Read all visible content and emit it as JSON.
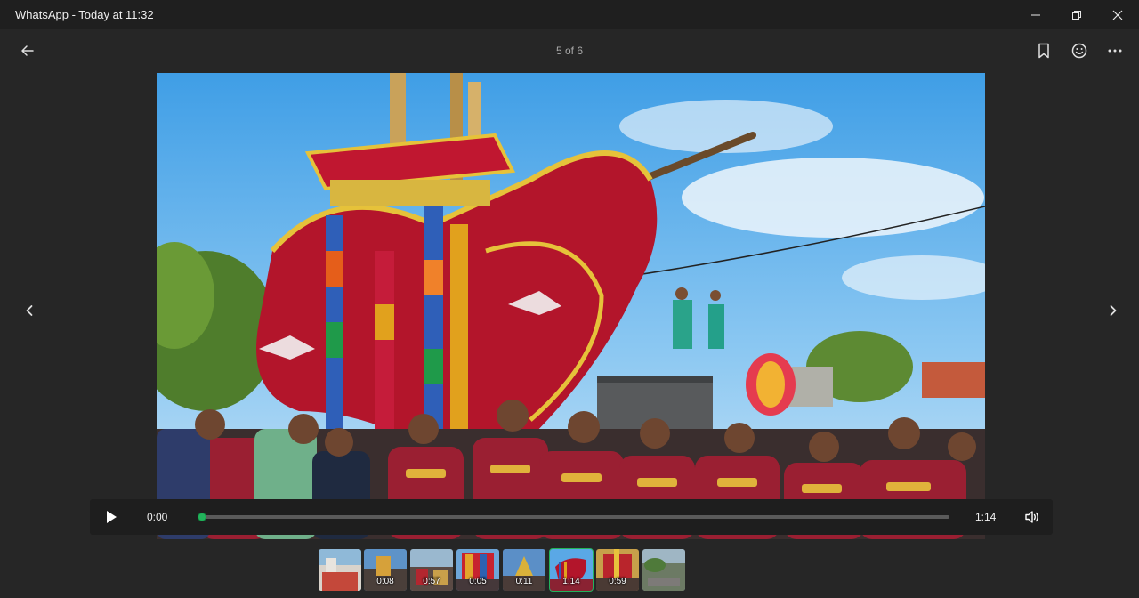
{
  "window": {
    "title": "WhatsApp - Today at 11:32",
    "controls": [
      "minimize-icon",
      "maximize-icon",
      "close-icon"
    ]
  },
  "header": {
    "counter": "5 of 6",
    "icons": [
      "back-arrow-icon",
      "bookmark-icon",
      "emoji-icon",
      "more-icon"
    ]
  },
  "player": {
    "current_time": "0:00",
    "total_time": "1:14",
    "progress": 0.0,
    "icons": [
      "play-icon",
      "volume-icon"
    ]
  },
  "navigation": {
    "icons": [
      "chevron-left-icon",
      "chevron-right-icon"
    ]
  },
  "thumbnails": [
    {
      "duration": "",
      "selected": false
    },
    {
      "duration": "0:08",
      "selected": false
    },
    {
      "duration": "0:57",
      "selected": false
    },
    {
      "duration": "0:05",
      "selected": false
    },
    {
      "duration": "0:11",
      "selected": false
    },
    {
      "duration": "1:14",
      "selected": true
    },
    {
      "duration": "0:59",
      "selected": false
    },
    {
      "duration": "",
      "selected": false
    }
  ],
  "colors": {
    "accent": "#22b35b",
    "background": "#262626",
    "titlebar": "#1f1f1f",
    "controls": "#1e1e1e"
  }
}
